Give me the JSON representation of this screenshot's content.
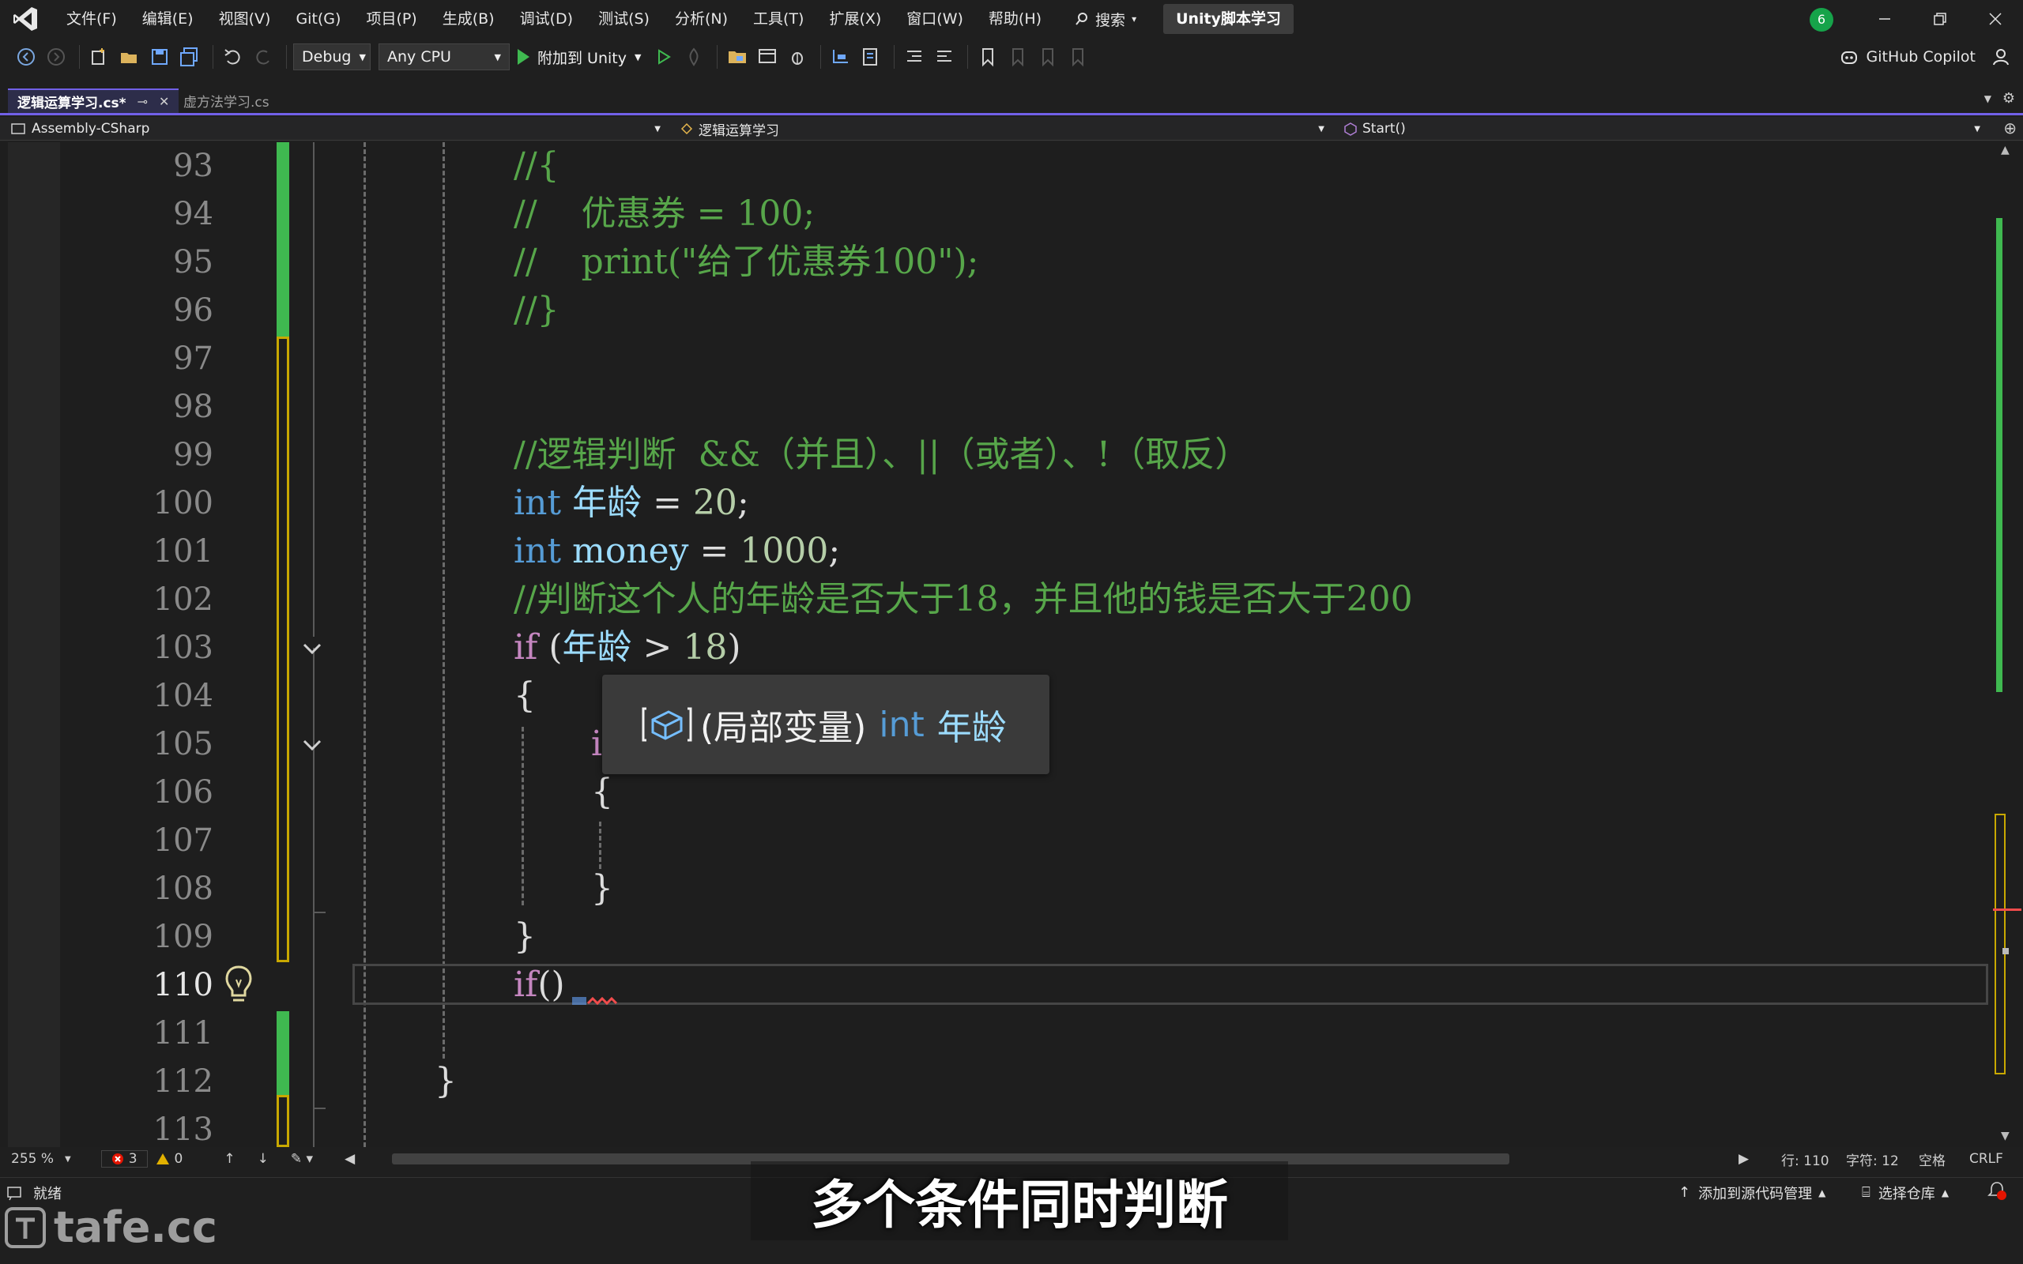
{
  "menu": [
    "文件(F)",
    "编辑(E)",
    "视图(V)",
    "Git(G)",
    "项目(P)",
    "生成(B)",
    "调试(D)",
    "测试(S)",
    "分析(N)",
    "工具(T)",
    "扩展(X)",
    "窗口(W)",
    "帮助(H)"
  ],
  "search_label": "搜索",
  "solution_name": "Unity脚本学习",
  "notification_count": "6",
  "toolbar": {
    "configuration": "Debug",
    "platform": "Any CPU",
    "attach_label": "附加到 Unity",
    "copilot_label": "GitHub Copilot"
  },
  "tabs": [
    {
      "label": "逻辑运算学习.cs*",
      "active": true
    },
    {
      "label": "虚方法学习.cs",
      "active": false
    }
  ],
  "nav": {
    "project": "Assembly-CSharp",
    "type": "逻辑运算学习",
    "member": "Start()"
  },
  "line_numbers": [
    "93",
    "94",
    "95",
    "96",
    "97",
    "98",
    "99",
    "100",
    "101",
    "102",
    "103",
    "104",
    "105",
    "106",
    "107",
    "108",
    "109",
    "110",
    "111",
    "112",
    "113"
  ],
  "current_line_number": "110",
  "code": {
    "l93": "//{",
    "l94": "//    优惠券 = 100;",
    "l95": "//    print(\"给了优惠券100\");",
    "l96": "//}",
    "l99": "//逻辑判断  &&（并且）、||（或者）、!（取反）",
    "l100_kw": "int",
    "l100_id": "年龄",
    "l100_op": " = ",
    "l100_num": "20",
    "l100_end": ";",
    "l101_kw": "int",
    "l101_id": "money",
    "l101_op": " = ",
    "l101_num": "1000",
    "l101_end": ";",
    "l102": "//判断这个人的年龄是否大于18，并且他的钱是否大于200",
    "l103_kw": "if",
    "l103_open": " (",
    "l103_id": "年龄",
    "l103_op": " > ",
    "l103_num": "18",
    "l103_close": ")",
    "l104": "{",
    "l105": "i",
    "l106": "{",
    "l108": "}",
    "l109": "}",
    "l110_kw": "if",
    "l110_rest": "()",
    "l112": "}"
  },
  "tooltip": {
    "kind": "(局部变量)",
    "type": "int",
    "name": "年龄"
  },
  "editor_status": {
    "zoom": "255 %",
    "errors": "3",
    "warnings": "0",
    "line": "行: 110",
    "char": "字符: 12",
    "whitespace": "空格",
    "eol": "CRLF"
  },
  "statusbar": {
    "ready": "就绪",
    "source_control": "添加到源代码管理",
    "repo": "选择仓库"
  },
  "subtitle": "多个条件同时判断",
  "watermark": "tafe.cc"
}
